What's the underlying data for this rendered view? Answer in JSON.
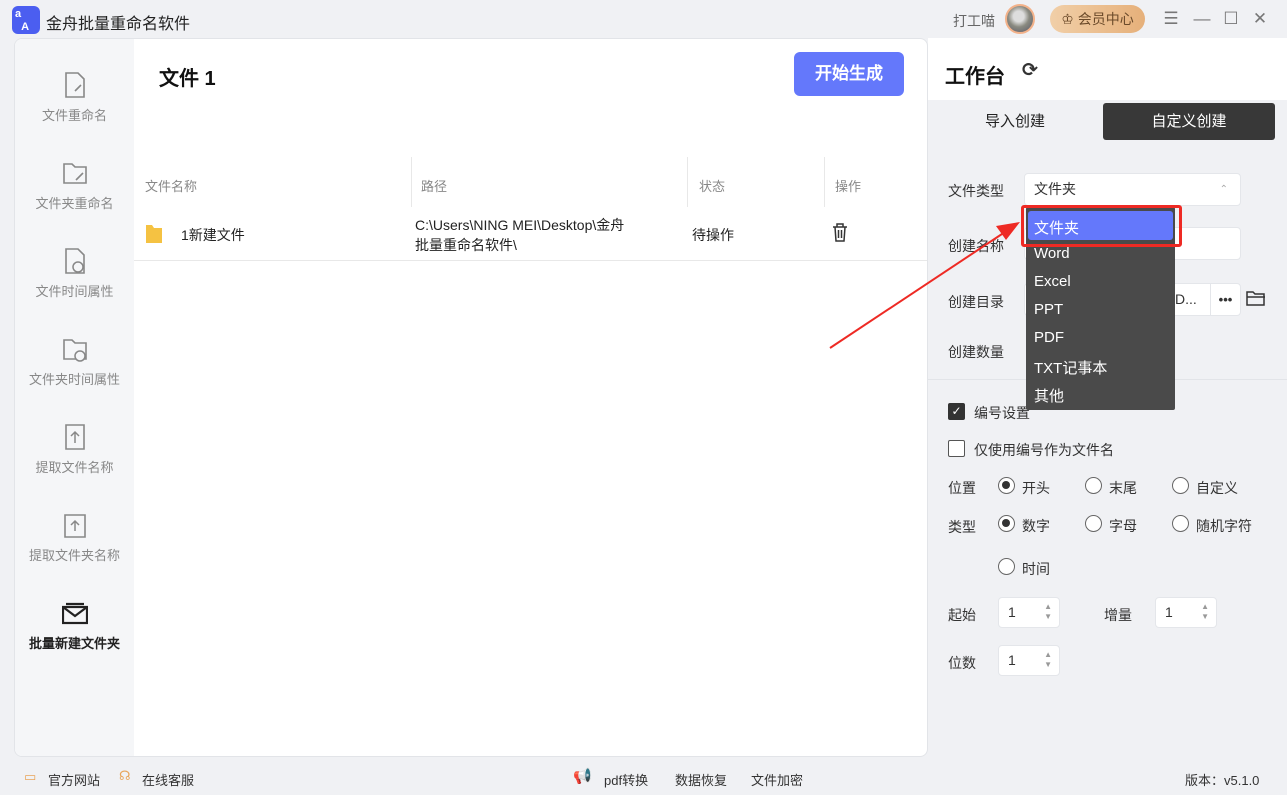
{
  "app": {
    "title": "金舟批量重命名软件",
    "logo_text": "aA",
    "user": "打工喵",
    "vip": "会员中心"
  },
  "sidebar": {
    "items": [
      {
        "label": "文件重命名"
      },
      {
        "label": "文件夹重命名"
      },
      {
        "label": "文件时间属性"
      },
      {
        "label": "文件夹时间属性"
      },
      {
        "label": "提取文件名称"
      },
      {
        "label": "提取文件夹名称"
      },
      {
        "label": "批量新建文件夹",
        "active": true
      }
    ]
  },
  "main": {
    "title": "文件 1",
    "start_button": "开始生成",
    "columns": [
      "文件名称",
      "路径",
      "状态",
      "操作"
    ],
    "rows": [
      {
        "name": "1新建文件",
        "path_line1": "C:\\Users\\NING MEI\\Desktop\\金舟",
        "path_line2": "批量重命名软件\\",
        "status": "待操作"
      }
    ]
  },
  "panel": {
    "title": "工作台",
    "tabs": [
      "导入创建",
      "自定义创建"
    ],
    "file_type_label": "文件类型",
    "file_type_value": "文件夹",
    "name_label": "创建名称",
    "dir_label": "创建目录",
    "dir_value": "D...",
    "dir_more": "•••",
    "count_label": "创建数量",
    "numbering_label": "编号设置",
    "only_number_label": "仅使用编号作为文件名",
    "position_label": "位置",
    "position_options": [
      "开头",
      "末尾",
      "自定义"
    ],
    "type_label": "类型",
    "type_options": [
      "数字",
      "字母",
      "随机字符",
      "时间"
    ],
    "start_label": "起始",
    "start_value": "1",
    "step_label": "增量",
    "step_value": "1",
    "digits_label": "位数",
    "digits_value": "1"
  },
  "dropdown": {
    "options": [
      "文件夹",
      "Word",
      "Excel",
      "PPT",
      "PDF",
      "TXT记事本",
      "其他"
    ],
    "selected": "文件夹"
  },
  "status": {
    "website": "官方网站",
    "support": "在线客服",
    "pdf": "pdf转换",
    "recover": "数据恢复",
    "encrypt": "文件加密",
    "version": "版本：v5.1.0"
  },
  "colors": {
    "accent": "#6478fb",
    "annotation": "#ee2a24",
    "dropdown_bg": "#4a4a4a"
  }
}
